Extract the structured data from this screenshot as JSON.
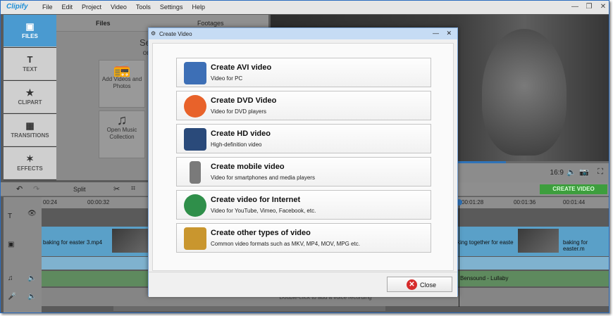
{
  "app": {
    "logo": "Clipify",
    "menu": [
      "File",
      "Edit",
      "Project",
      "Video",
      "Tools",
      "Settings",
      "Help"
    ],
    "window_buttons": [
      "—",
      "❐",
      "✕"
    ]
  },
  "sidebar": {
    "items": [
      {
        "label": "FILES",
        "icon": "▣"
      },
      {
        "label": "TEXT",
        "icon": "T"
      },
      {
        "label": "CLIPART",
        "icon": "★"
      },
      {
        "label": "TRANSITIONS",
        "icon": "▦"
      },
      {
        "label": "EFFECTS",
        "icon": "✶"
      }
    ]
  },
  "files_panel": {
    "tabs": [
      "Files",
      "Footages"
    ],
    "heading": "Select the f",
    "subheading": "or just drop t",
    "tiles": [
      {
        "label": "Add Videos and Photos",
        "icon": "📻"
      },
      {
        "label": "Open Music Collection",
        "icon": "♫"
      }
    ]
  },
  "preview": {
    "aspect_ratio": "16:9",
    "progress": 0.695
  },
  "toolbar": {
    "split_label": "Split",
    "create_video_label": "CREATE VIDEO"
  },
  "timeline": {
    "ruler_labels": [
      "00:24",
      "00:00:32",
      "00:01:28",
      "00:01:36",
      "00:01:44"
    ],
    "clips": [
      "baking for easter 3.mp4",
      "king together for easte",
      "baking for easter.m"
    ],
    "audio_label": "Bensound - Lullaby",
    "voice_hint": "Double-click to add a voice recording"
  },
  "dialog": {
    "title": "Create Video",
    "options": [
      {
        "title": "Create AVI video",
        "desc": "Video for PC",
        "icon": "avi-icon",
        "color": "#3d6fb6"
      },
      {
        "title": "Create DVD Video",
        "desc": "Video for DVD players",
        "icon": "dvd-icon",
        "color": "#e8622a"
      },
      {
        "title": "Create HD video",
        "desc": "High-definition video",
        "icon": "hd-monitor-icon",
        "color": "#2a4a7a"
      },
      {
        "title": "Create mobile video",
        "desc": "Video for smartphones and media players",
        "icon": "mobile-icon",
        "color": "#7a7a7a"
      },
      {
        "title": "Create video for Internet",
        "desc": "Video for YouTube, Vimeo, Facebook, etc.",
        "icon": "globe-icon",
        "color": "#2f8f4a"
      },
      {
        "title": "Create other types of video",
        "desc": "Common video formats such as MKV, MP4, MOV, MPG etc.",
        "icon": "film-file-icon",
        "color": "#c9962e"
      }
    ],
    "close_label": "Close"
  }
}
